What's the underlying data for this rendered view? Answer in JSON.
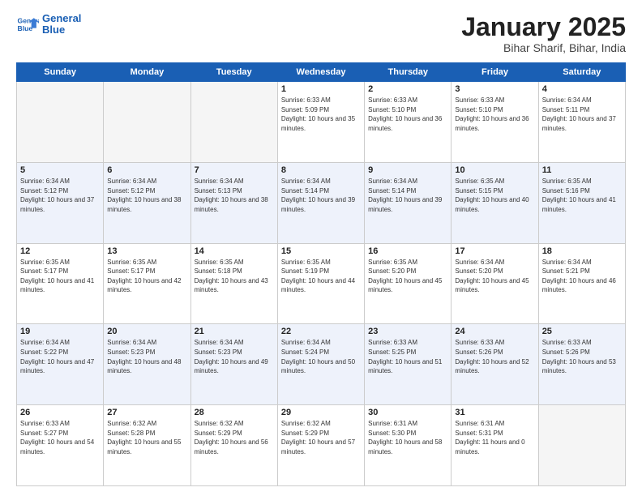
{
  "logo": {
    "line1": "General",
    "line2": "Blue"
  },
  "title": "January 2025",
  "subtitle": "Bihar Sharif, Bihar, India",
  "days_of_week": [
    "Sunday",
    "Monday",
    "Tuesday",
    "Wednesday",
    "Thursday",
    "Friday",
    "Saturday"
  ],
  "weeks": [
    [
      {
        "day": "",
        "empty": true
      },
      {
        "day": "",
        "empty": true
      },
      {
        "day": "",
        "empty": true
      },
      {
        "day": "1",
        "sunrise": "6:33 AM",
        "sunset": "5:09 PM",
        "daylight": "10 hours and 35 minutes."
      },
      {
        "day": "2",
        "sunrise": "6:33 AM",
        "sunset": "5:10 PM",
        "daylight": "10 hours and 36 minutes."
      },
      {
        "day": "3",
        "sunrise": "6:33 AM",
        "sunset": "5:10 PM",
        "daylight": "10 hours and 36 minutes."
      },
      {
        "day": "4",
        "sunrise": "6:34 AM",
        "sunset": "5:11 PM",
        "daylight": "10 hours and 37 minutes."
      }
    ],
    [
      {
        "day": "5",
        "sunrise": "6:34 AM",
        "sunset": "5:12 PM",
        "daylight": "10 hours and 37 minutes."
      },
      {
        "day": "6",
        "sunrise": "6:34 AM",
        "sunset": "5:12 PM",
        "daylight": "10 hours and 38 minutes."
      },
      {
        "day": "7",
        "sunrise": "6:34 AM",
        "sunset": "5:13 PM",
        "daylight": "10 hours and 38 minutes."
      },
      {
        "day": "8",
        "sunrise": "6:34 AM",
        "sunset": "5:14 PM",
        "daylight": "10 hours and 39 minutes."
      },
      {
        "day": "9",
        "sunrise": "6:34 AM",
        "sunset": "5:14 PM",
        "daylight": "10 hours and 39 minutes."
      },
      {
        "day": "10",
        "sunrise": "6:35 AM",
        "sunset": "5:15 PM",
        "daylight": "10 hours and 40 minutes."
      },
      {
        "day": "11",
        "sunrise": "6:35 AM",
        "sunset": "5:16 PM",
        "daylight": "10 hours and 41 minutes."
      }
    ],
    [
      {
        "day": "12",
        "sunrise": "6:35 AM",
        "sunset": "5:17 PM",
        "daylight": "10 hours and 41 minutes."
      },
      {
        "day": "13",
        "sunrise": "6:35 AM",
        "sunset": "5:17 PM",
        "daylight": "10 hours and 42 minutes."
      },
      {
        "day": "14",
        "sunrise": "6:35 AM",
        "sunset": "5:18 PM",
        "daylight": "10 hours and 43 minutes."
      },
      {
        "day": "15",
        "sunrise": "6:35 AM",
        "sunset": "5:19 PM",
        "daylight": "10 hours and 44 minutes."
      },
      {
        "day": "16",
        "sunrise": "6:35 AM",
        "sunset": "5:20 PM",
        "daylight": "10 hours and 45 minutes."
      },
      {
        "day": "17",
        "sunrise": "6:34 AM",
        "sunset": "5:20 PM",
        "daylight": "10 hours and 45 minutes."
      },
      {
        "day": "18",
        "sunrise": "6:34 AM",
        "sunset": "5:21 PM",
        "daylight": "10 hours and 46 minutes."
      }
    ],
    [
      {
        "day": "19",
        "sunrise": "6:34 AM",
        "sunset": "5:22 PM",
        "daylight": "10 hours and 47 minutes."
      },
      {
        "day": "20",
        "sunrise": "6:34 AM",
        "sunset": "5:23 PM",
        "daylight": "10 hours and 48 minutes."
      },
      {
        "day": "21",
        "sunrise": "6:34 AM",
        "sunset": "5:23 PM",
        "daylight": "10 hours and 49 minutes."
      },
      {
        "day": "22",
        "sunrise": "6:34 AM",
        "sunset": "5:24 PM",
        "daylight": "10 hours and 50 minutes."
      },
      {
        "day": "23",
        "sunrise": "6:33 AM",
        "sunset": "5:25 PM",
        "daylight": "10 hours and 51 minutes."
      },
      {
        "day": "24",
        "sunrise": "6:33 AM",
        "sunset": "5:26 PM",
        "daylight": "10 hours and 52 minutes."
      },
      {
        "day": "25",
        "sunrise": "6:33 AM",
        "sunset": "5:26 PM",
        "daylight": "10 hours and 53 minutes."
      }
    ],
    [
      {
        "day": "26",
        "sunrise": "6:33 AM",
        "sunset": "5:27 PM",
        "daylight": "10 hours and 54 minutes."
      },
      {
        "day": "27",
        "sunrise": "6:32 AM",
        "sunset": "5:28 PM",
        "daylight": "10 hours and 55 minutes."
      },
      {
        "day": "28",
        "sunrise": "6:32 AM",
        "sunset": "5:29 PM",
        "daylight": "10 hours and 56 minutes."
      },
      {
        "day": "29",
        "sunrise": "6:32 AM",
        "sunset": "5:29 PM",
        "daylight": "10 hours and 57 minutes."
      },
      {
        "day": "30",
        "sunrise": "6:31 AM",
        "sunset": "5:30 PM",
        "daylight": "10 hours and 58 minutes."
      },
      {
        "day": "31",
        "sunrise": "6:31 AM",
        "sunset": "5:31 PM",
        "daylight": "11 hours and 0 minutes."
      },
      {
        "day": "",
        "empty": true
      }
    ]
  ]
}
